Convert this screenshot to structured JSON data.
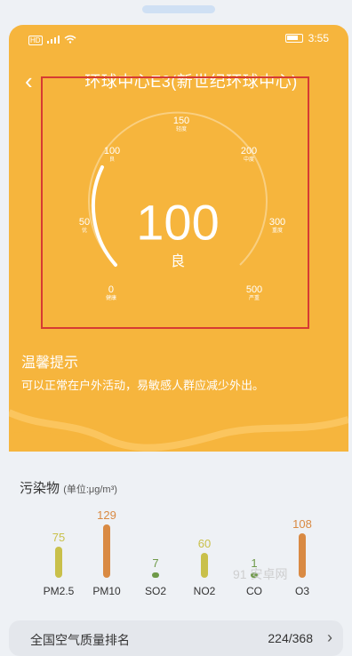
{
  "status_bar": {
    "network": "HD",
    "battery": "",
    "time": "3:55"
  },
  "header": {
    "back": "‹",
    "title": "环球中心E3(新世纪环球中心)"
  },
  "gauge": {
    "value": "100",
    "grade": "良",
    "ticks": [
      {
        "value": "0",
        "grade": "健康"
      },
      {
        "value": "50",
        "grade": "优"
      },
      {
        "value": "100",
        "grade": "良"
      },
      {
        "value": "150",
        "grade": "轻度"
      },
      {
        "value": "200",
        "grade": "中度"
      },
      {
        "value": "300",
        "grade": "重度"
      },
      {
        "value": "500",
        "grade": "严重"
      }
    ],
    "colors": {
      "card": "#f6b53d",
      "arc": "#ffffff",
      "frame": "#d63b33"
    }
  },
  "tips": {
    "title": "温馨提示",
    "text": "可以正常在户外活动，易敏感人群应减少外出。"
  },
  "pollutants": {
    "title": "污染物",
    "unit": "(单位:μg/m³)",
    "items": [
      {
        "name": "PM2.5",
        "value": "75",
        "color": "#c9c04a",
        "level": 0.58
      },
      {
        "name": "PM10",
        "value": "129",
        "color": "#d98a43",
        "level": 1.0
      },
      {
        "name": "SO2",
        "value": "7",
        "color": "#6f9a49",
        "level": 0.1
      },
      {
        "name": "NO2",
        "value": "60",
        "color": "#c9c04a",
        "level": 0.47
      },
      {
        "name": "CO",
        "value": "1",
        "color": "#6f9a49",
        "level": 0.08
      },
      {
        "name": "O3",
        "value": "108",
        "color": "#d98a43",
        "level": 0.84
      }
    ]
  },
  "ranking": {
    "label": "全国空气质量排名",
    "value": "224/368",
    "chevron": "›"
  },
  "watermark": "91 安卓网"
}
